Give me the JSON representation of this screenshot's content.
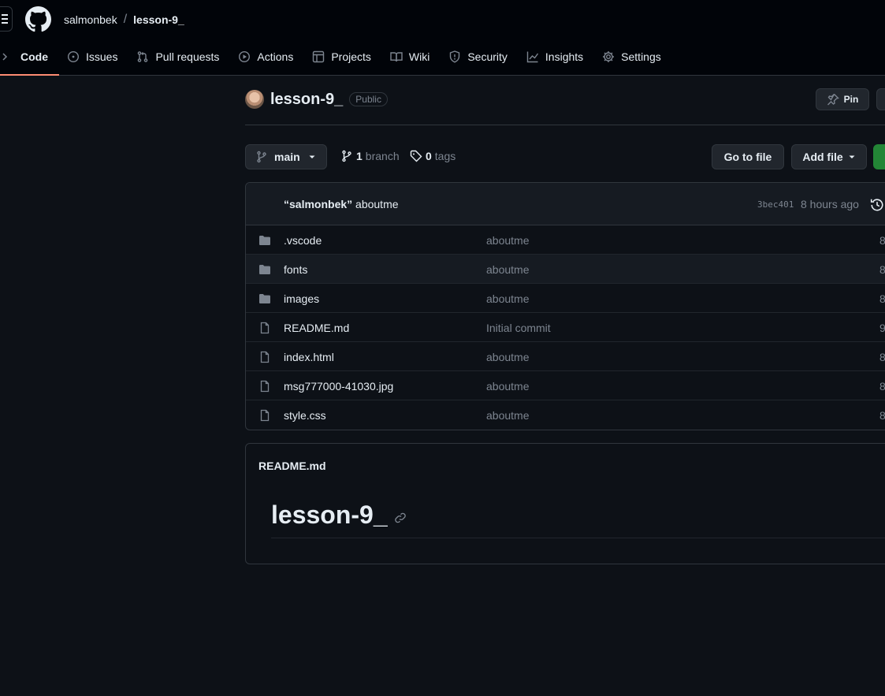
{
  "header": {
    "owner": "salmonbek",
    "separator": "/",
    "repo": "lesson-9_"
  },
  "tabs": [
    {
      "label": "Code",
      "icon": "code-icon",
      "active": true
    },
    {
      "label": "Issues",
      "icon": "issue-icon"
    },
    {
      "label": "Pull requests",
      "icon": "pull-request-icon"
    },
    {
      "label": "Actions",
      "icon": "play-icon"
    },
    {
      "label": "Projects",
      "icon": "table-icon"
    },
    {
      "label": "Wiki",
      "icon": "book-icon"
    },
    {
      "label": "Security",
      "icon": "shield-icon"
    },
    {
      "label": "Insights",
      "icon": "graph-icon"
    },
    {
      "label": "Settings",
      "icon": "gear-icon"
    }
  ],
  "repo": {
    "name": "lesson-9_",
    "visibility": "Public",
    "pin_label": "Pin"
  },
  "branch_bar": {
    "branch": "main",
    "branch_count": "1",
    "branch_label": "branch",
    "tag_count": "0",
    "tag_label": "tags",
    "go_to_file": "Go to file",
    "add_file": "Add file"
  },
  "commit": {
    "author": "“salmonbek”",
    "message": "aboutme",
    "hash": "3bec401",
    "time": "8 hours ago"
  },
  "files": [
    {
      "name": ".vscode",
      "type": "dir",
      "message": "aboutme",
      "age": "8"
    },
    {
      "name": "fonts",
      "type": "dir",
      "message": "aboutme",
      "age": "8"
    },
    {
      "name": "images",
      "type": "dir",
      "message": "aboutme",
      "age": "8"
    },
    {
      "name": "README.md",
      "type": "file",
      "message": "Initial commit",
      "age": "9"
    },
    {
      "name": "index.html",
      "type": "file",
      "message": "aboutme",
      "age": "8"
    },
    {
      "name": "msg777000-41030.jpg",
      "type": "file",
      "message": "aboutme",
      "age": "8"
    },
    {
      "name": "style.css",
      "type": "file",
      "message": "aboutme",
      "age": "8"
    }
  ],
  "readme": {
    "filename": "README.md",
    "heading": "lesson-9_"
  },
  "colors": {
    "background": "#0d1117",
    "header": "#010409",
    "border": "#30363d",
    "muted": "#7d8590",
    "active_tab": "#fd8c73",
    "primary_button": "#238636"
  }
}
